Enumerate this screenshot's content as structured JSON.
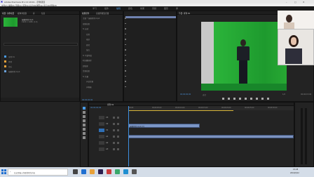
{
  "titlebar": {
    "title": "Adobe Premiere Pro CC 2019 - 示例项目"
  },
  "menubar": {
    "items": [
      "文件(F)",
      "编辑(E)",
      "剪辑(C)",
      "序列(S)",
      "标记(M)",
      "图形(G)",
      "窗口(W)",
      "帮助(H)"
    ]
  },
  "workspace_tabs": {
    "items": [
      "学习",
      "组件",
      "编辑",
      "颜色",
      "效果",
      "音频",
      "图形",
      "库"
    ],
    "active_index": 2
  },
  "project_panel": {
    "tabs": [
      "项目: 示例项目",
      "媒体浏览器",
      "库",
      "信息"
    ],
    "clip_name": "绿幕素材.mp4",
    "items": [
      {
        "name": "序列 01",
        "color": "#4a9be6"
      },
      {
        "name": "素材",
        "color": "#e8a13a"
      },
      {
        "name": "音乐",
        "color": "#e8a13a"
      },
      {
        "name": "绿幕素材.mp4",
        "color": "#6aa0d8"
      }
    ]
  },
  "effect_controls": {
    "tabs": [
      "效果控件",
      "音频剪辑混合器"
    ],
    "rows": [
      "主要 * 绿幕素材.mp4",
      "视频效果",
      "fx 运动",
      "位置",
      "缩放",
      "旋转",
      "锚点",
      "fx 不透明度",
      "时间重映射",
      "超级键",
      "音频效果",
      "fx 音量",
      "声道音量",
      "声像器"
    ],
    "timecode": "00;00;00;00"
  },
  "program_monitor": {
    "tab": "节目: 序列 01",
    "timecode": "00;00;00;00",
    "fit": "适合",
    "scale": "1/2",
    "duration": "00;00;15;00"
  },
  "timeline": {
    "tab": "序列 01",
    "timecode": "00;00;00;00",
    "ruler_labels": [
      "00;00",
      "00;00;05;00",
      "00;00;10;00",
      "00;00;15;00",
      "00;00;20;00",
      "00;00;25;00",
      "00;00;30;00"
    ],
    "tracks": [
      "V3",
      "V2",
      "V1",
      "A1",
      "A2",
      "A3"
    ],
    "clip_label": "绿幕素材.mp4 [V]"
  },
  "taskbar": {
    "search_placeholder": "在这里输入你要搜索的内容",
    "time": "15:28",
    "date": "2019/9/12"
  }
}
